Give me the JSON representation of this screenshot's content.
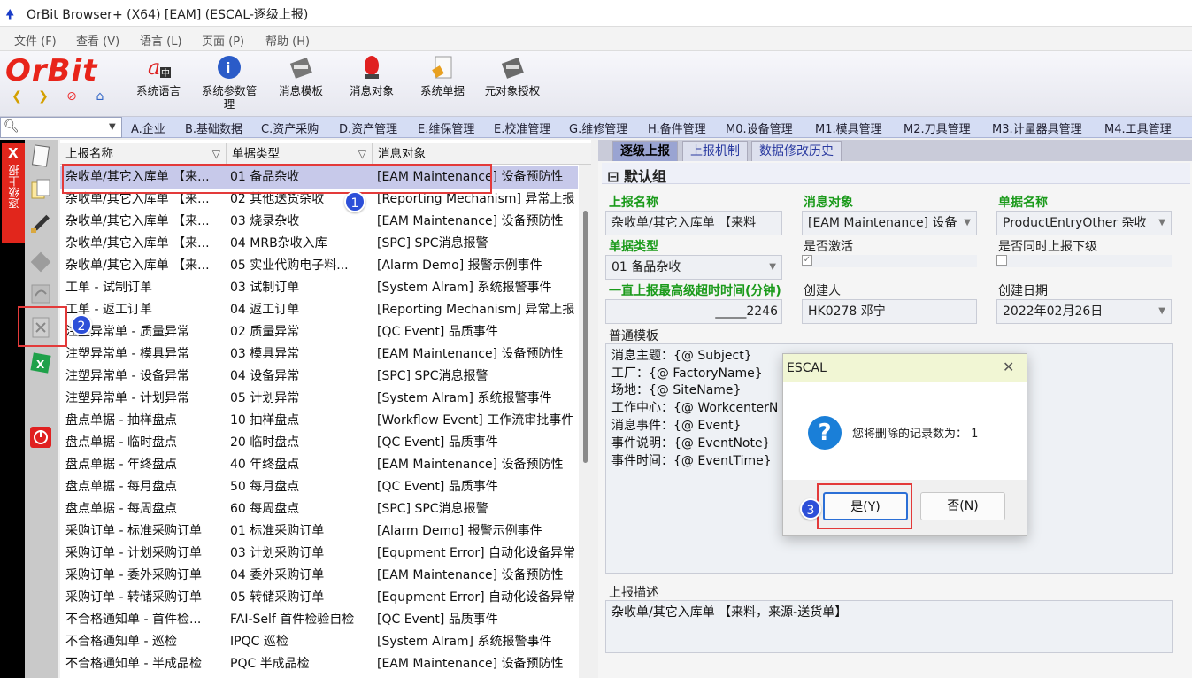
{
  "window": {
    "title": "OrBit Browser+ (X64) [EAM] (ESCAL-逐级上报)"
  },
  "menu": [
    "文件 (F)",
    "查看 (V)",
    "语言 (L)",
    "页面 (P)",
    "帮助 (H)"
  ],
  "logo": "OrBit",
  "toolbar": [
    {
      "label": "系统语言",
      "icon": "language-icon"
    },
    {
      "label": "系统参数管",
      "label2": "理",
      "icon": "system-params-icon"
    },
    {
      "label": "消息模板",
      "icon": "message-template-icon"
    },
    {
      "label": "消息对象",
      "icon": "message-object-icon"
    },
    {
      "label": "系统单据",
      "icon": "system-docs-icon"
    },
    {
      "label": "元对象授权",
      "icon": "meta-auth-icon"
    }
  ],
  "modules": [
    "A.企业",
    "B.基础数据",
    "C.资产采购",
    "D.资产管理",
    "E.维保管理",
    "E.校准管理",
    "G.维修管理",
    "H.备件管理",
    "M0.设备管理",
    "M1.模具管理",
    "M2.刀具管理",
    "M3.计量器具管理",
    "M4.工具管理"
  ],
  "vertical_tab": "逐级上报",
  "grid": {
    "headers": [
      "上报名称",
      "单据类型",
      "消息对象"
    ],
    "rows": [
      {
        "c1": "杂收单/其它入库单 【来...",
        "c2": "01 备品杂收",
        "c3": "[EAM Maintenance] 设备预防性"
      },
      {
        "c1": "杂收单/其它入库单 【来...",
        "c2": "02 其他送货杂收",
        "c3": "[Reporting Mechanism] 异常上报"
      },
      {
        "c1": "杂收单/其它入库单 【来...",
        "c2": "03 烧录杂收",
        "c3": "[EAM Maintenance] 设备预防性"
      },
      {
        "c1": "杂收单/其它入库单 【来...",
        "c2": "04 MRB杂收入库",
        "c3": "[SPC] SPC消息报警"
      },
      {
        "c1": "杂收单/其它入库单 【来...",
        "c2": "05 实业代购电子料...",
        "c3": "[Alarm Demo] 报警示例事件"
      },
      {
        "c1": "工单 - 试制订单",
        "c2": "03 试制订单",
        "c3": "[System Alram] 系统报警事件"
      },
      {
        "c1": "工单 - 返工订单",
        "c2": "04 返工订单",
        "c3": "[Reporting Mechanism] 异常上报"
      },
      {
        "c1": "注塑异常单 - 质量异常",
        "c2": "02 质量异常",
        "c3": "[QC Event] 品质事件"
      },
      {
        "c1": "注塑异常单 - 模具异常",
        "c2": "03 模具异常",
        "c3": "[EAM Maintenance] 设备预防性"
      },
      {
        "c1": "注塑异常单 - 设备异常",
        "c2": "04 设备异常",
        "c3": "[SPC] SPC消息报警"
      },
      {
        "c1": "注塑异常单 - 计划异常",
        "c2": "05 计划异常",
        "c3": "[System Alram] 系统报警事件"
      },
      {
        "c1": "盘点单据 - 抽样盘点",
        "c2": "10 抽样盘点",
        "c3": "[Workflow Event] 工作流审批事件"
      },
      {
        "c1": "盘点单据 - 临时盘点",
        "c2": "20 临时盘点",
        "c3": "[QC Event] 品质事件"
      },
      {
        "c1": "盘点单据 - 年终盘点",
        "c2": "40 年终盘点",
        "c3": "[EAM Maintenance] 设备预防性"
      },
      {
        "c1": "盘点单据 - 每月盘点",
        "c2": "50 每月盘点",
        "c3": "[QC Event] 品质事件"
      },
      {
        "c1": "盘点单据 - 每周盘点",
        "c2": "60 每周盘点",
        "c3": "[SPC] SPC消息报警"
      },
      {
        "c1": "采购订单 - 标准采购订单",
        "c2": "01 标准采购订单",
        "c3": "[Alarm Demo] 报警示例事件"
      },
      {
        "c1": "采购订单 - 计划采购订单",
        "c2": "03 计划采购订单",
        "c3": "[Equpment Error] 自动化设备异常"
      },
      {
        "c1": "采购订单 - 委外采购订单",
        "c2": "04 委外采购订单",
        "c3": "[EAM Maintenance] 设备预防性"
      },
      {
        "c1": "采购订单 - 转储采购订单",
        "c2": "05 转储采购订单",
        "c3": "[Equpment Error] 自动化设备异常"
      },
      {
        "c1": "不合格通知单 - 首件检...",
        "c2": "FAI-Self 首件检验自检",
        "c3": "[QC Event] 品质事件"
      },
      {
        "c1": "不合格通知单 - 巡检",
        "c2": "IPQC 巡检",
        "c3": "[System Alram] 系统报警事件"
      },
      {
        "c1": "不合格通知单 - 半成品检",
        "c2": "PQC 半成品检",
        "c3": "[EAM Maintenance] 设备预防性"
      }
    ]
  },
  "tabs": [
    "逐级上报",
    "上报机制",
    "数据修改历史"
  ],
  "group": "默认组",
  "form": {
    "report_name_label": "上报名称",
    "report_name": "杂收单/其它入库单 【来料",
    "msg_obj_label": "消息对象",
    "msg_obj": "[EAM Maintenance] 设备",
    "doc_name_label": "单据名称",
    "doc_name": "ProductEntryOther 杂收",
    "doc_type_label": "单据类型",
    "doc_type": "01 备品杂收",
    "active_label": "是否激活",
    "sync_label": "是否同时上报下级",
    "timeout_label": "一直上报最高级超时时间(分钟)",
    "timeout": "_____2246",
    "creator_label": "创建人",
    "creator": "HK0278 邓宁",
    "created_date_label": "创建日期",
    "created_date": "2022年02月26日",
    "template_label": "普通模板",
    "template_lines": [
      "消息主题：{@ Subject}",
      "工厂：{@ FactoryName}",
      "场地：{@ SiteName}",
      "工作中心：{@ WorkcenterN",
      "消息事件：{@ Event}",
      "事件说明：{@ EventNote}",
      "事件时间：{@ EventTime}"
    ],
    "desc_label": "上报描述",
    "desc": "杂收单/其它入库单 【来料，来源-送货单】"
  },
  "dialog": {
    "title": "ESCAL",
    "message": "您将删除的记录数为：  1",
    "yes": "是(Y)",
    "no": "否(N)"
  },
  "badges": [
    "1",
    "2",
    "3"
  ]
}
